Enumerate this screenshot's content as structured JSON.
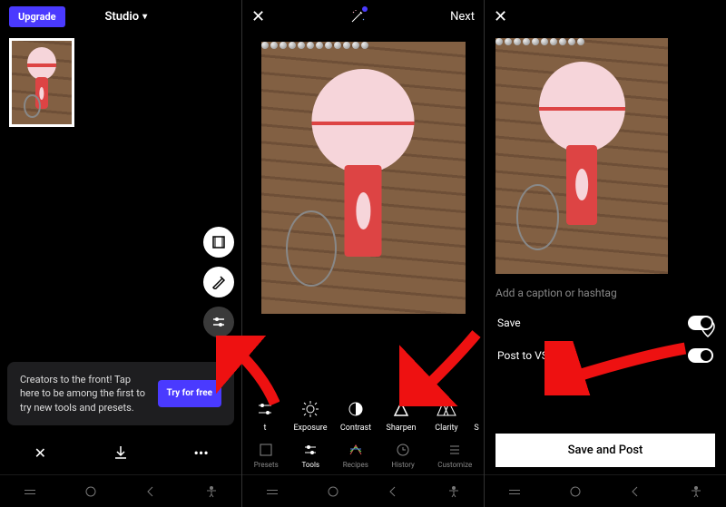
{
  "screen1": {
    "upgrade_label": "Upgrade",
    "studio_label": "Studio",
    "banner_text": "Creators to the front! Tap here to be among the first to try new tools and presets.",
    "tryfree_label": "Try for free"
  },
  "screen2": {
    "next_label": "Next",
    "tools": [
      {
        "label": "t",
        "icon": "adjust"
      },
      {
        "label": "Exposure",
        "icon": "sun"
      },
      {
        "label": "Contrast",
        "icon": "half-circle"
      },
      {
        "label": "Sharpen",
        "icon": "triangle"
      },
      {
        "label": "Clarity",
        "icon": "dbl-triangle"
      },
      {
        "label": "S",
        "icon": ""
      }
    ],
    "tabs": [
      {
        "label": "Presets",
        "icon": "film",
        "active": false
      },
      {
        "label": "Tools",
        "icon": "sliders",
        "active": true
      },
      {
        "label": "Recipes",
        "icon": "stack",
        "active": false
      },
      {
        "label": "History",
        "icon": "history",
        "active": false
      },
      {
        "label": "Customize",
        "icon": "customize",
        "active": false
      }
    ]
  },
  "screen3": {
    "caption_placeholder": "Add a caption or hashtag",
    "rows": [
      {
        "label": "Save"
      },
      {
        "label": "Post to VSCO"
      }
    ],
    "savepost_label": "Save and Post"
  }
}
